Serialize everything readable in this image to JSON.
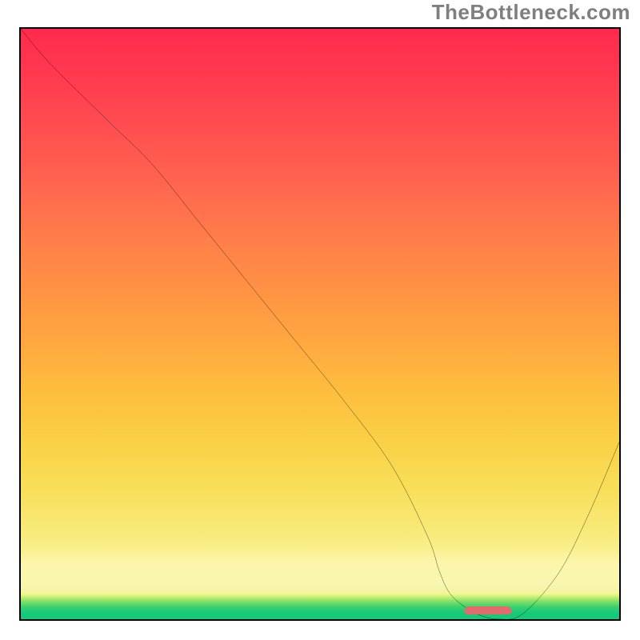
{
  "watermark": "TheBottleneck.com",
  "chart_data": {
    "type": "line",
    "title": "",
    "xlabel": "",
    "ylabel": "",
    "xlim": [
      0,
      100
    ],
    "ylim": [
      0,
      100
    ],
    "grid": false,
    "series": [
      {
        "name": "bottleneck-curve",
        "x": [
          0,
          5,
          15,
          22,
          30,
          38,
          46,
          54,
          62,
          68,
          70,
          72,
          76,
          80,
          84,
          90,
          95,
          100
        ],
        "y": [
          100,
          94,
          84,
          77,
          67,
          57,
          47,
          37,
          26,
          14,
          8,
          4,
          1,
          0,
          1,
          8,
          18,
          30
        ]
      }
    ],
    "annotations": [
      {
        "name": "optimal-range-marker",
        "x_start": 74,
        "x_end": 82,
        "y": 0,
        "color": "#e46a6d"
      }
    ],
    "background_gradient": {
      "stops": [
        {
          "pos": 0.0,
          "color": "#ff2a4d"
        },
        {
          "pos": 0.35,
          "color": "#ff7f49"
        },
        {
          "pos": 0.65,
          "color": "#f9d146"
        },
        {
          "pos": 0.9,
          "color": "#faf298"
        },
        {
          "pos": 0.97,
          "color": "#7de06a"
        },
        {
          "pos": 1.0,
          "color": "#15c97b"
        }
      ]
    }
  }
}
